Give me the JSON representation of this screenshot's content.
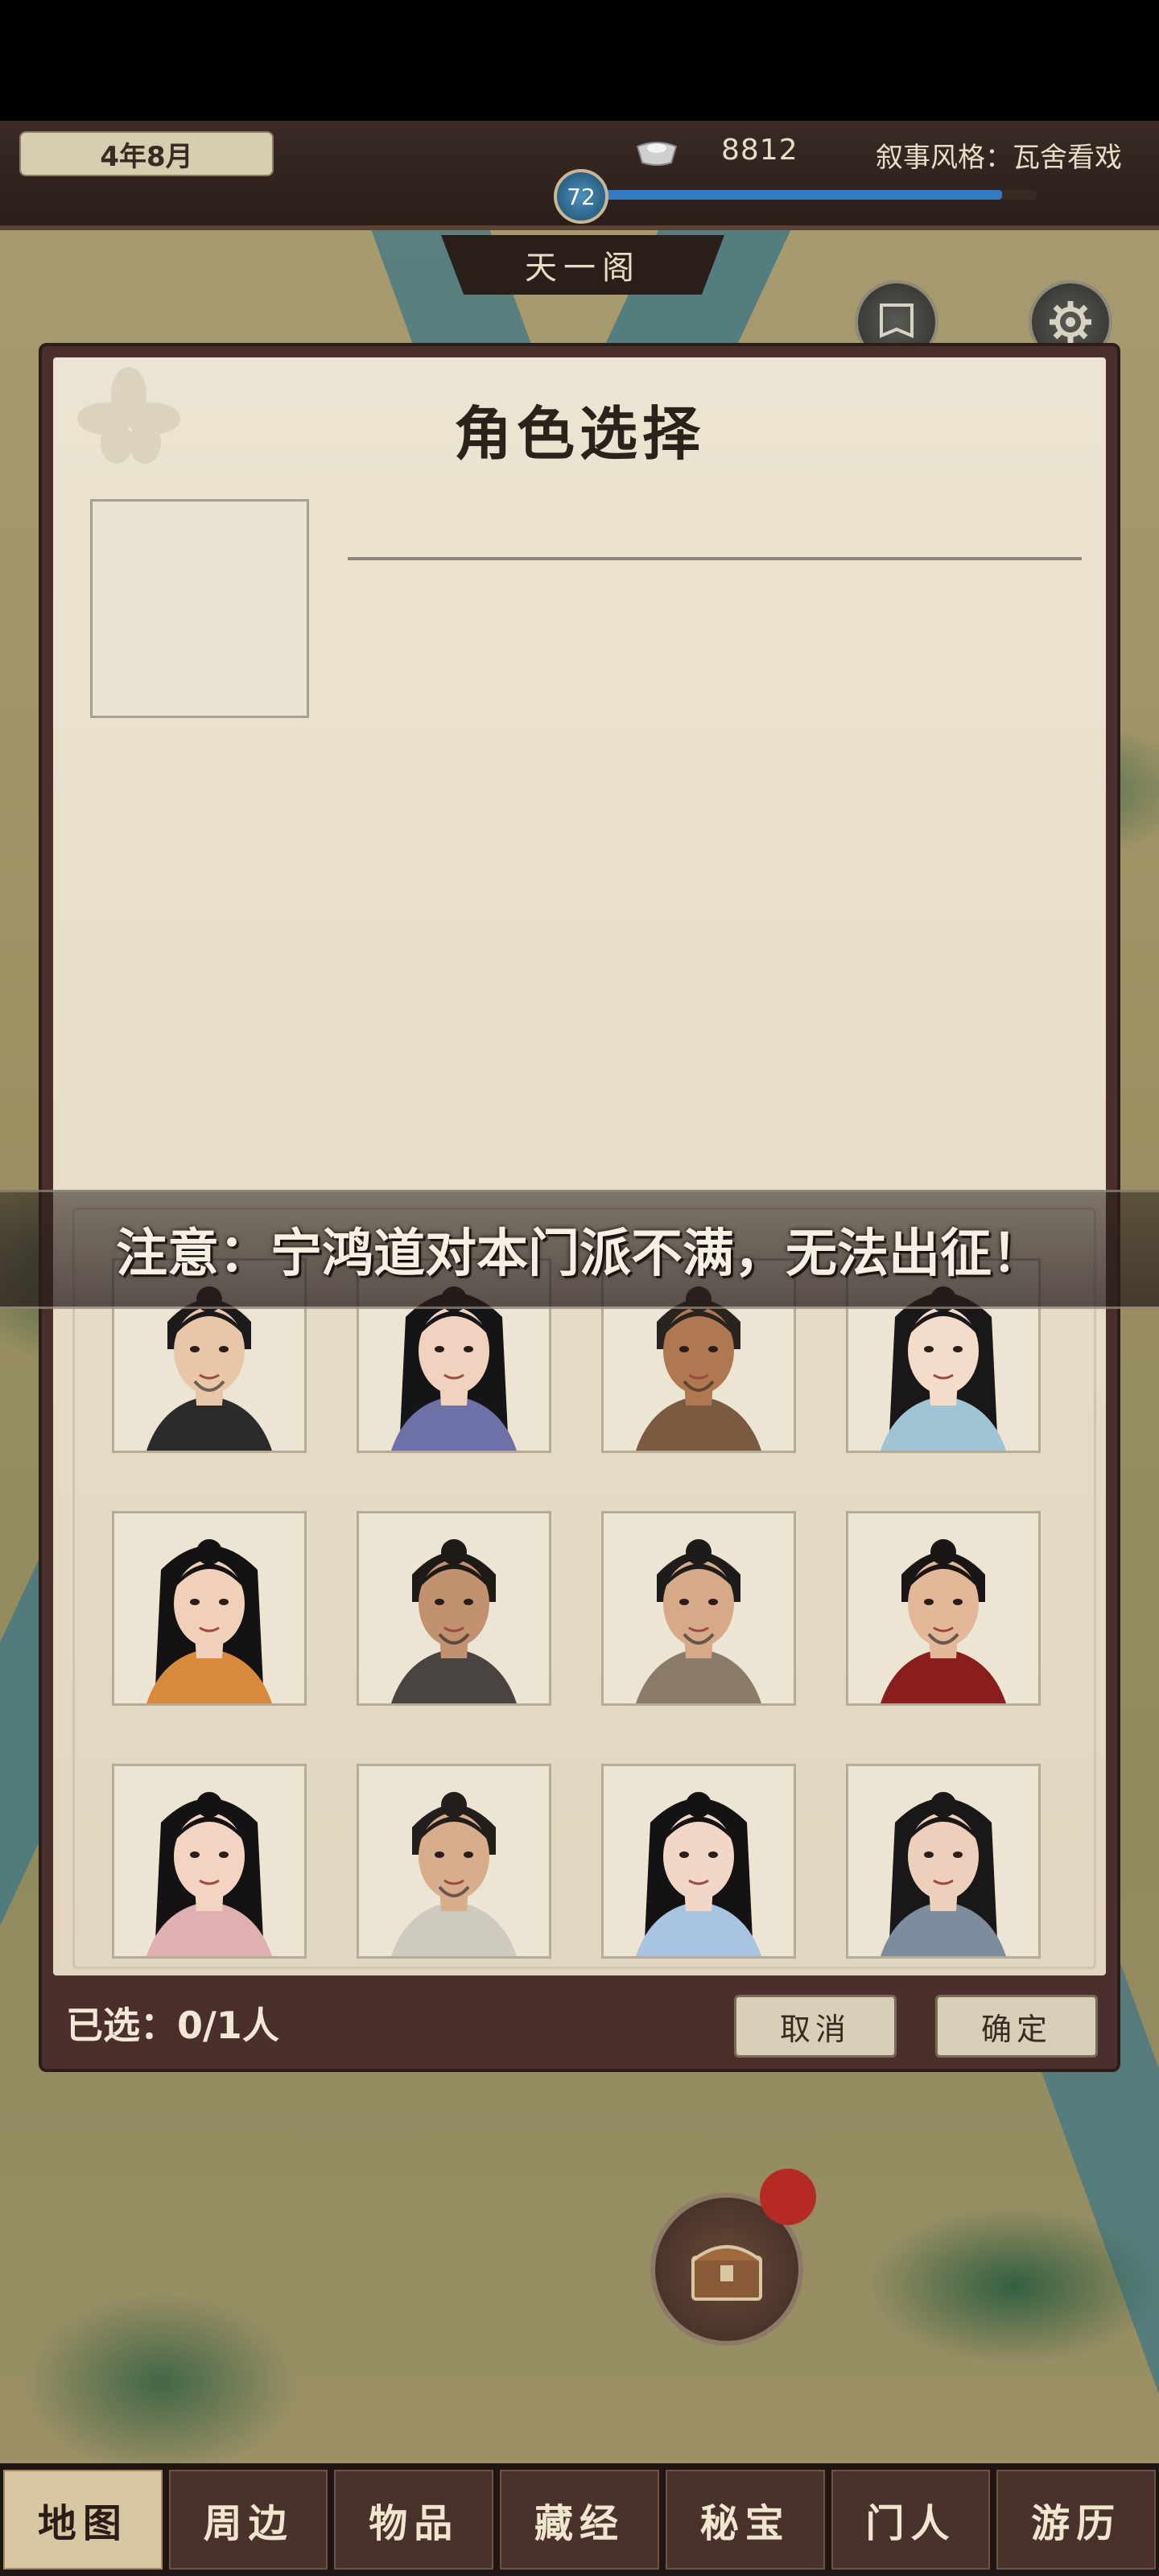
{
  "topbar": {
    "date": "4年8月",
    "silver": "8812",
    "narrative_style": "叙事风格：瓦舍看戏",
    "level": "72",
    "xp_fraction": 0.92
  },
  "location": "天一阁",
  "dialog": {
    "title": "角色选择",
    "notice": "注意：宁鸿道对本门派不满，无法出征！",
    "selected_count": "已选：0/1人",
    "cancel": "取消",
    "confirm": "确定"
  },
  "characters": [
    {
      "name": "char-1",
      "skin": "#e8c7a8",
      "hair": "#1c1a1a",
      "robe": "#2b2b2b",
      "female": false
    },
    {
      "name": "char-2",
      "skin": "#f1d2bf",
      "hair": "#151417",
      "robe": "#6e70a8",
      "female": true
    },
    {
      "name": "char-3",
      "skin": "#b07850",
      "hair": "#2a2420",
      "robe": "#7a5a40",
      "female": false
    },
    {
      "name": "char-4",
      "skin": "#f4dccb",
      "hair": "#1a1718",
      "robe": "#9ec4d6",
      "female": true
    },
    {
      "name": "char-5",
      "skin": "#f0d0b8",
      "hair": "#141213",
      "robe": "#d88a3a",
      "female": true
    },
    {
      "name": "char-6",
      "skin": "#c29270",
      "hair": "#1e1a18",
      "robe": "#4a4440",
      "female": false
    },
    {
      "name": "char-7",
      "skin": "#d6aa88",
      "hair": "#1e1c1a",
      "robe": "#8a7a6a",
      "female": false
    },
    {
      "name": "char-8",
      "skin": "#e2b898",
      "hair": "#1a1616",
      "robe": "#8a1e1e",
      "female": false
    },
    {
      "name": "char-9",
      "skin": "#f3d4c2",
      "hair": "#141213",
      "robe": "#e0b0b0",
      "female": true
    },
    {
      "name": "char-10",
      "skin": "#d8ad8c",
      "hair": "#221e1c",
      "robe": "#cfcac0",
      "female": false
    },
    {
      "name": "char-11",
      "skin": "#f2d6c6",
      "hair": "#141213",
      "robe": "#a8c4e0",
      "female": true
    },
    {
      "name": "char-12",
      "skin": "#edd0bc",
      "hair": "#1a1718",
      "robe": "#7c8c9c",
      "female": true
    }
  ],
  "nav": {
    "items": [
      "地图",
      "周边",
      "物品",
      "藏经",
      "秘宝",
      "门人",
      "游历"
    ],
    "active_index": 0
  },
  "colors": {
    "accent_blue": "#2f7bc6",
    "notification_red": "#b52a22"
  }
}
